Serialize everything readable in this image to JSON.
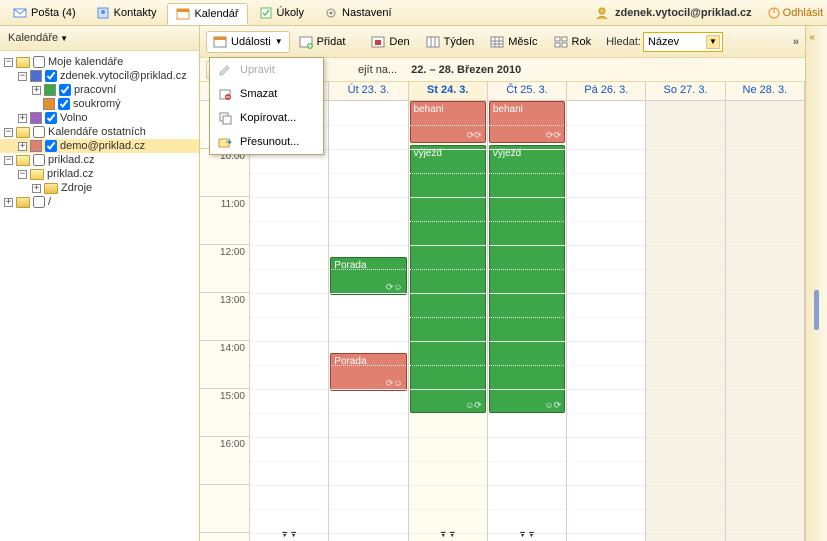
{
  "topbar": {
    "tabs": [
      {
        "label": "Pošta (4)",
        "iconColor": "#5b8def"
      },
      {
        "label": "Kontakty",
        "iconColor": "#5b8def"
      },
      {
        "label": "Kalendář",
        "iconColor": "#e89030",
        "active": true
      },
      {
        "label": "Úkoly",
        "iconColor": "#5bbf5b"
      },
      {
        "label": "Nastavení",
        "iconColor": "#888888"
      }
    ],
    "user": "zdenek.vytocil@priklad.cz",
    "logout": "Odhlásit"
  },
  "sidebar": {
    "title": "Kalendáře",
    "nodes": {
      "my": "Moje kalendáře",
      "user": "zdenek.vytocil@priklad.cz",
      "work": "pracovní",
      "private": "soukromý",
      "free": "Volno",
      "others": "Kalendáře ostatních",
      "demo": "demo@priklad.cz",
      "domain": "priklad.cz",
      "domain2": "priklad.cz",
      "resources": "Zdroje",
      "slash": "/"
    },
    "colors": {
      "user": "#4a6fd0",
      "work": "#3da648",
      "private": "#e89030",
      "free": "#a060c0",
      "demo": "#e08070"
    }
  },
  "toolbar": {
    "events": "Události",
    "add": "Přidat",
    "day": "Den",
    "week": "Týden",
    "month": "Měsíc",
    "year": "Rok",
    "search_label": "Hledat:",
    "search_value": "Název",
    "today_partial": "ejít na..."
  },
  "dropdown": {
    "edit": "Upravit",
    "delete": "Smazat",
    "copy": "Kopírovat...",
    "move": "Přesunout..."
  },
  "calendar": {
    "week_title": "22. – 28. Březen 2010",
    "days": [
      "",
      "Út 23. 3.",
      "St 24. 3.",
      "Čt 25. 3.",
      "Pá 26. 3.",
      "So 27. 3.",
      "Ne 28. 3."
    ],
    "hours": [
      "",
      "10:00",
      "11:00",
      "12:00",
      "13:00",
      "14:00",
      "15:00",
      "16:00"
    ],
    "events": {
      "behani": "behani",
      "vyjezd": "výjezd",
      "porada": "Porada"
    }
  }
}
